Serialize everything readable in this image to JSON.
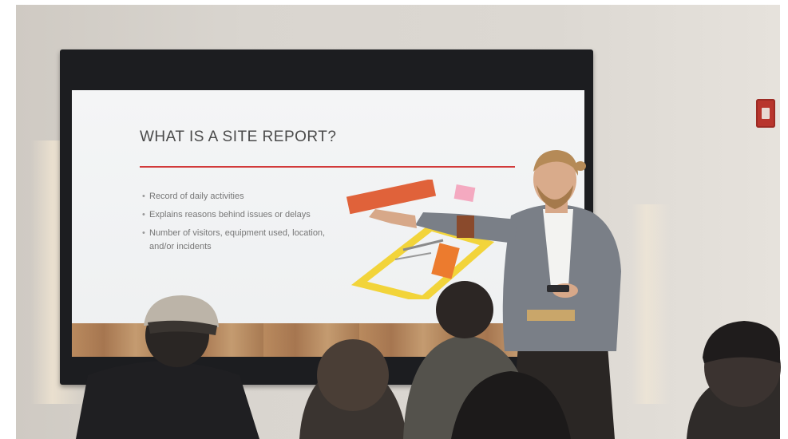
{
  "slide": {
    "title": "WHAT IS A SITE REPORT?",
    "bullets": [
      "Record of daily activities",
      "Explains reasons behind issues or delays",
      "Number of visitors, equipment used, location, and/or incidents"
    ]
  },
  "colors": {
    "slide_accent": "#d23a3a",
    "graphic_orange": "#e0623a",
    "graphic_yellow": "#f2d43a",
    "graphic_pink": "#f4a9c0",
    "blazer": "#7a7f87",
    "fire_alarm": "#b8352d"
  }
}
